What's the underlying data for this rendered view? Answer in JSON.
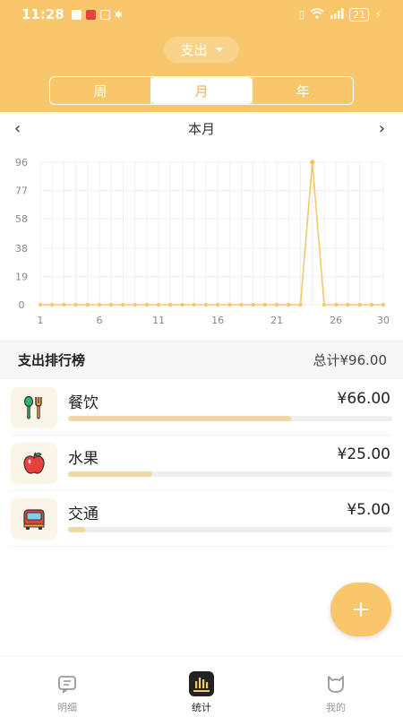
{
  "status_bar": {
    "time": "11:28",
    "battery": "21"
  },
  "header": {
    "type_select": "支出",
    "segments": [
      "周",
      "月",
      "年"
    ],
    "active_segment": "月"
  },
  "period": {
    "prev": "‹",
    "label": "本月",
    "next": "›"
  },
  "chart_data": {
    "type": "line",
    "x": [
      1,
      2,
      3,
      4,
      5,
      6,
      7,
      8,
      9,
      10,
      11,
      12,
      13,
      14,
      15,
      16,
      17,
      18,
      19,
      20,
      21,
      22,
      23,
      24,
      25,
      26,
      27,
      28,
      29,
      30
    ],
    "series": [
      {
        "values": [
          0,
          0,
          0,
          0,
          0,
          0,
          0,
          0,
          0,
          0,
          0,
          0,
          0,
          0,
          0,
          0,
          0,
          0,
          0,
          0,
          0,
          0,
          0,
          96,
          0,
          0,
          0,
          0,
          0,
          0
        ]
      }
    ],
    "y_ticks": [
      "0",
      "19",
      "38",
      "58",
      "77",
      "96"
    ],
    "x_ticks": [
      "1",
      "6",
      "11",
      "16",
      "21",
      "26",
      "30"
    ],
    "ylim": [
      0,
      96
    ],
    "grid": true,
    "color": "#F8C66B"
  },
  "ranking": {
    "title": "支出排行榜",
    "total": "总计¥96.00",
    "items": [
      {
        "name": "餐饮",
        "amount": "¥66.00",
        "share": 0.6875,
        "icon": "fork-spoon-icon"
      },
      {
        "name": "水果",
        "amount": "¥25.00",
        "share": 0.26,
        "icon": "apple-icon"
      },
      {
        "name": "交通",
        "amount": "¥5.00",
        "share": 0.052,
        "icon": "bus-icon"
      }
    ]
  },
  "fab": {
    "label": "+"
  },
  "tabbar": [
    {
      "label": "明细",
      "icon": "list-icon"
    },
    {
      "label": "统计",
      "icon": "chart-icon",
      "active": true
    },
    {
      "label": "我的",
      "icon": "cat-icon"
    }
  ],
  "colors": {
    "accent": "#F8C66B",
    "bar": "#F1D9A6"
  }
}
